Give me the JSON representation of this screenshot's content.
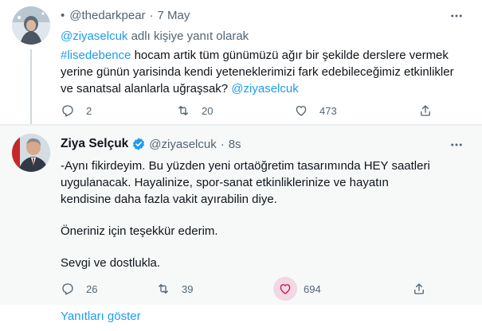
{
  "tweet1": {
    "bullet": "•",
    "handle": "@thedarkpear",
    "separator": "·",
    "date": "7 May",
    "reply_mention": "@ziyaselcuk",
    "reply_suffix": " adlı kişiye yanıt olarak",
    "hashtag": "#lisedebence",
    "text": " hocam artik tüm günümüzü ağır bir şekilde derslere vermek yerine günün yarisinda kendi yeteneklerimizi fark edebileceğimiz etkinlikler ve sanatsal alanlarla uğraşsak? ",
    "text_mention": "@ziyaselcuk",
    "replies": "2",
    "retweets": "20",
    "likes": "473"
  },
  "tweet2": {
    "display_name": "Ziya Selçuk",
    "handle": "@ziyaselcuk",
    "separator": "·",
    "time": "8s",
    "paragraph1": "-Aynı fikirdeyim. Bu yüzden yeni ortaöğretim tasarımında HEY saatleri uygulanacak. Hayalinize, spor-sanat etkinliklerinize ve hayatın kendisine daha fazla vakit ayırabilin diye.",
    "paragraph2": "Öneriniz için teşekkür ederim.",
    "paragraph3": "Sevgi ve dostlukla.",
    "replies": "26",
    "retweets": "39",
    "likes": "694"
  },
  "show_replies": "Yanıtları göster",
  "icons": {
    "more": "more-horizontal-icon",
    "reply": "reply-icon",
    "retweet": "retweet-icon",
    "like": "heart-icon",
    "share": "share-icon",
    "verified": "verified-badge-icon"
  },
  "colors": {
    "accent": "#1d9bf0",
    "muted": "#536471",
    "like_highlight": "#f91880"
  }
}
